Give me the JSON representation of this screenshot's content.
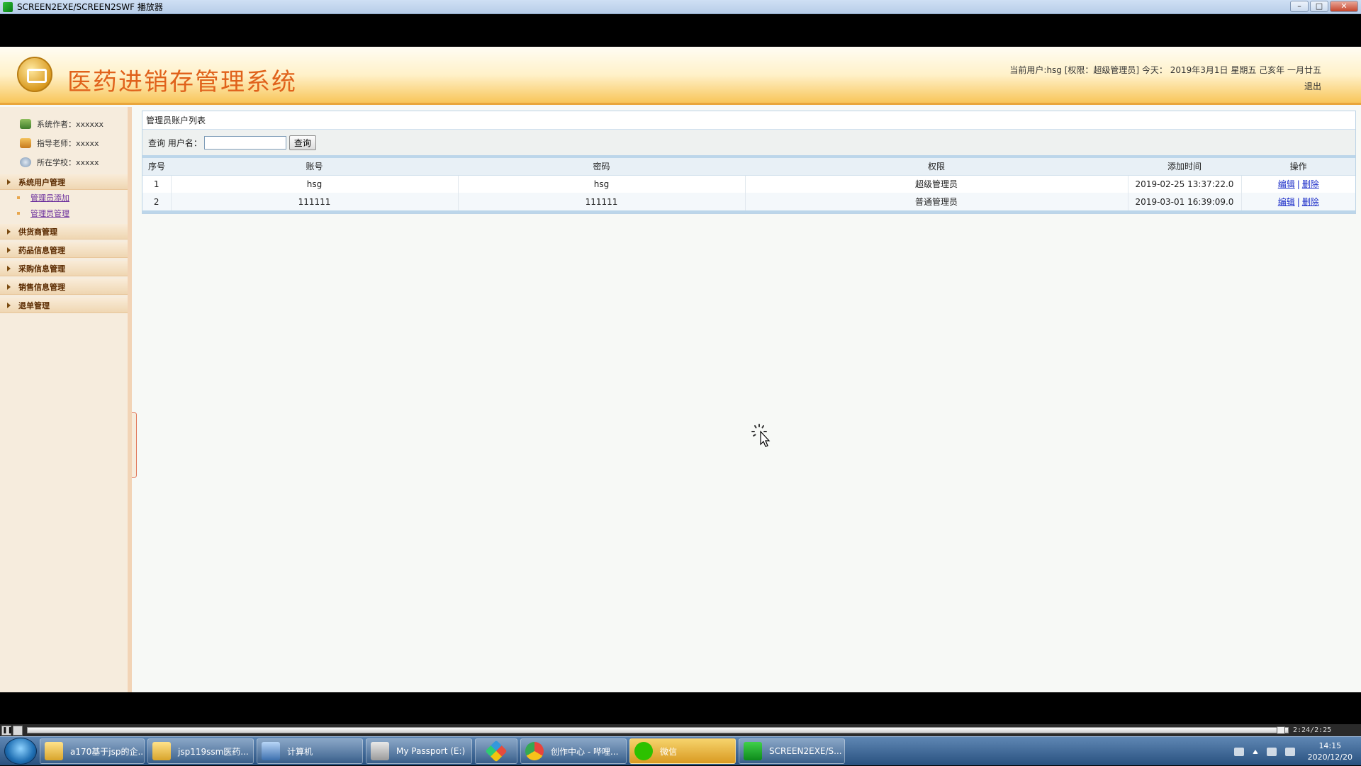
{
  "window": {
    "title": "SCREEN2EXE/SCREEN2SWF 播放器",
    "min_glyph": "–",
    "max_glyph": "□",
    "close_glyph": "✕"
  },
  "app": {
    "title": "医药进销存管理系统",
    "user_info": "当前用户:hsg [权限：超级管理员] 今天： 2019年3月1日 星期五 己亥年 一月廿五",
    "logout": "退出"
  },
  "sidebar": {
    "info": [
      {
        "label": "系统作者：xxxxxx"
      },
      {
        "label": "指导老师：xxxxx"
      },
      {
        "label": "所在学校：xxxxx"
      }
    ],
    "menu": [
      {
        "label": "系统用户管理",
        "children": [
          "管理员添加",
          "管理员管理"
        ]
      },
      {
        "label": "供货商管理"
      },
      {
        "label": "药品信息管理"
      },
      {
        "label": "采购信息管理"
      },
      {
        "label": "销售信息管理"
      },
      {
        "label": "退单管理"
      }
    ]
  },
  "main": {
    "panel_title": "管理员账户列表",
    "search": {
      "label": "查询 用户名：",
      "value": "",
      "button": "查询"
    },
    "table": {
      "columns": [
        "序号",
        "账号",
        "密码",
        "权限",
        "添加时间",
        "操作"
      ],
      "rows": [
        {
          "index": "1",
          "account": "hsg",
          "password": "hsg",
          "role": "超级管理员",
          "added": "2019-02-25 13:37:22.0",
          "edit": "编辑",
          "delete": "删除"
        },
        {
          "index": "2",
          "account": "111111",
          "password": "111111",
          "role": "普通管理员",
          "added": "2019-03-01 16:39:09.0",
          "edit": "编辑",
          "delete": "删除"
        }
      ],
      "op_separator": "|"
    }
  },
  "player": {
    "pause_glyph": "❚❚",
    "time": "2:24/2:25"
  },
  "taskbar": {
    "tasks": [
      {
        "label": "a170基于jsp的企...",
        "icon": "folder-icon"
      },
      {
        "label": "jsp119ssm医药...",
        "icon": "folder-icon"
      },
      {
        "label": "计算机",
        "icon": "computer-icon"
      },
      {
        "label": "My Passport (E:)",
        "icon": "drive-icon"
      },
      {
        "label": "",
        "icon": "colorful-app-icon"
      },
      {
        "label": "创作中心 - 哔哩...",
        "icon": "chrome-icon"
      },
      {
        "label": "微信",
        "icon": "wechat-icon"
      },
      {
        "label": "SCREEN2EXE/S...",
        "icon": "screen2exe-icon"
      }
    ],
    "clock_time": "14:15",
    "clock_date": "2020/12/20"
  },
  "colors": {
    "title_orange": "#e0621b",
    "link_blue": "#1a2cc8",
    "submenu_purple": "#6a2d9c"
  }
}
